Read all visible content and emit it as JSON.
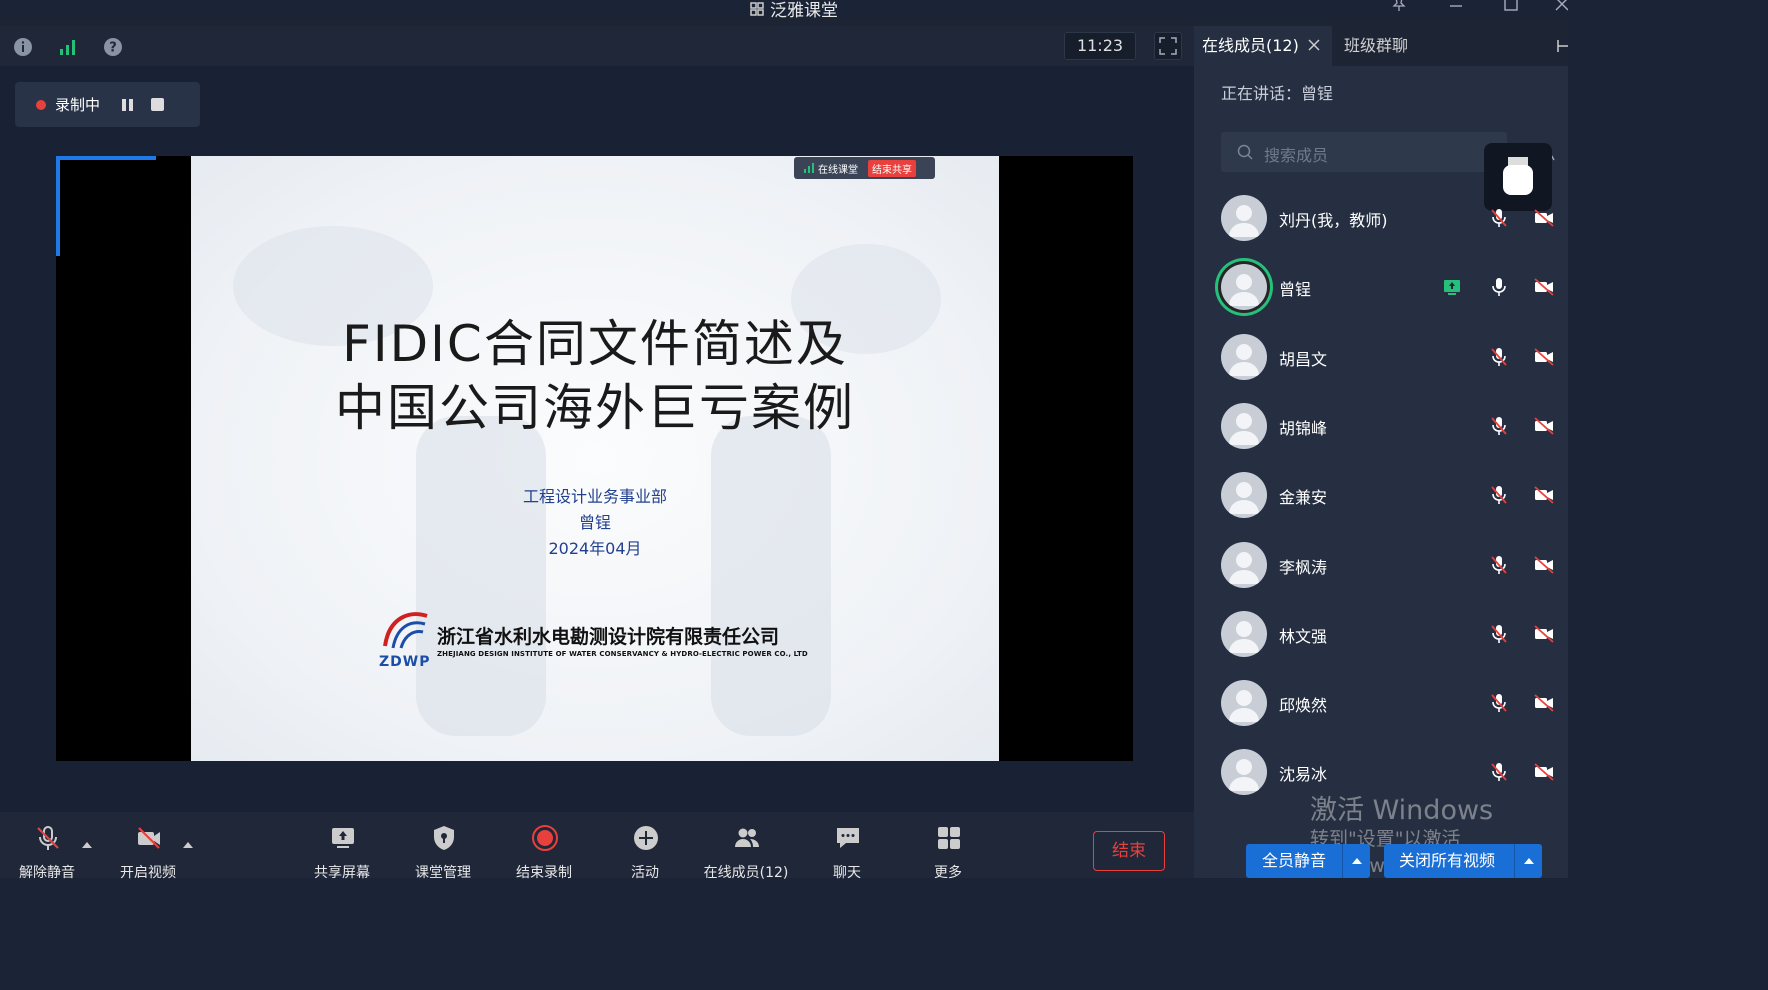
{
  "window": {
    "title": "泛雅课堂",
    "icons": [
      "pin-icon",
      "minimize-icon",
      "maximize-icon",
      "close-icon"
    ]
  },
  "topbar": {
    "icons": [
      "info-icon",
      "signal-icon",
      "help-icon"
    ],
    "clock": "11:23"
  },
  "recording": {
    "label": "录制中"
  },
  "slide": {
    "share_bar_label": "在线课堂",
    "share_bar_end": "结束共享",
    "title_line1": "FIDIC合同文件简述及",
    "title_line2": "中国公司海外巨亏案例",
    "department": "工程设计业务事业部",
    "presenter": "曾锃",
    "date": "2024年04月",
    "logo_text": "ZDWP",
    "company_cn": "浙江省水利水电勘测设计院有限责任公司",
    "company_en": "ZHEJIANG DESIGN INSTITUTE OF WATER CONSERVANCY & HYDRO-ELECTRIC POWER CO., LTD"
  },
  "toolbar": {
    "unmute": "解除静音",
    "start_video": "开启视频",
    "share_screen": "共享屏幕",
    "class_manage": "课堂管理",
    "stop_record": "结束录制",
    "activity": "活动",
    "online_members": "在线成员(12)",
    "chat": "聊天",
    "more": "更多",
    "end": "结束"
  },
  "panel": {
    "tab_members": "在线成员(12)",
    "tab_group_chat": "班级群聊",
    "speaking_label": "正在讲话：曾锃",
    "search_placeholder": "搜索成员",
    "members": [
      {
        "name": "刘丹(我，教师)",
        "mic": "muted",
        "cam": "off"
      },
      {
        "name": "曾锃",
        "mic": "on",
        "cam": "off",
        "sharing": true,
        "speaking": true
      },
      {
        "name": "胡昌文",
        "mic": "muted",
        "cam": "off"
      },
      {
        "name": "胡锦峰",
        "mic": "muted",
        "cam": "off"
      },
      {
        "name": "金兼安",
        "mic": "muted",
        "cam": "off"
      },
      {
        "name": "李枫涛",
        "mic": "muted",
        "cam": "off"
      },
      {
        "name": "林文强",
        "mic": "muted",
        "cam": "off"
      },
      {
        "name": "邱焕然",
        "mic": "muted",
        "cam": "off"
      },
      {
        "name": "沈易冰",
        "mic": "muted",
        "cam": "off"
      }
    ],
    "mute_all": "全员静音",
    "close_all_video": "关闭所有视频",
    "watermark_line1": "激活 Windows",
    "watermark_line2": "转到\"设置\"以激活 Windows。"
  },
  "colors": {
    "accent": "#1a6fd6",
    "recording_red": "#e8403d",
    "speaking_green": "#27c07a"
  }
}
